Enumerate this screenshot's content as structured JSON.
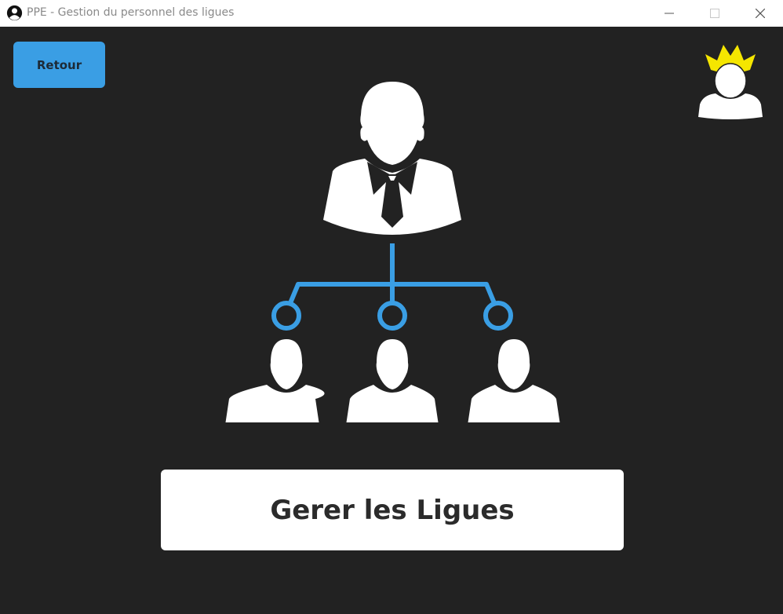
{
  "window": {
    "title": "PPE - Gestion du personnel des ligues",
    "icon": "user-circle-icon",
    "controls": [
      "minimize-icon",
      "maximize-icon",
      "close-icon"
    ]
  },
  "toolbar": {
    "back_label": "Retour"
  },
  "avatar": {
    "icon": "crowned-user-icon",
    "crown_color": "#f5e600"
  },
  "illustration": {
    "icon": "org-hierarchy-icon",
    "connector_color": "#3a9ee4"
  },
  "main": {
    "action_label": "Gerer les Ligues"
  },
  "colors": {
    "background": "#222222",
    "accent": "#3a9ee4",
    "titlebar": "#ffffff"
  }
}
